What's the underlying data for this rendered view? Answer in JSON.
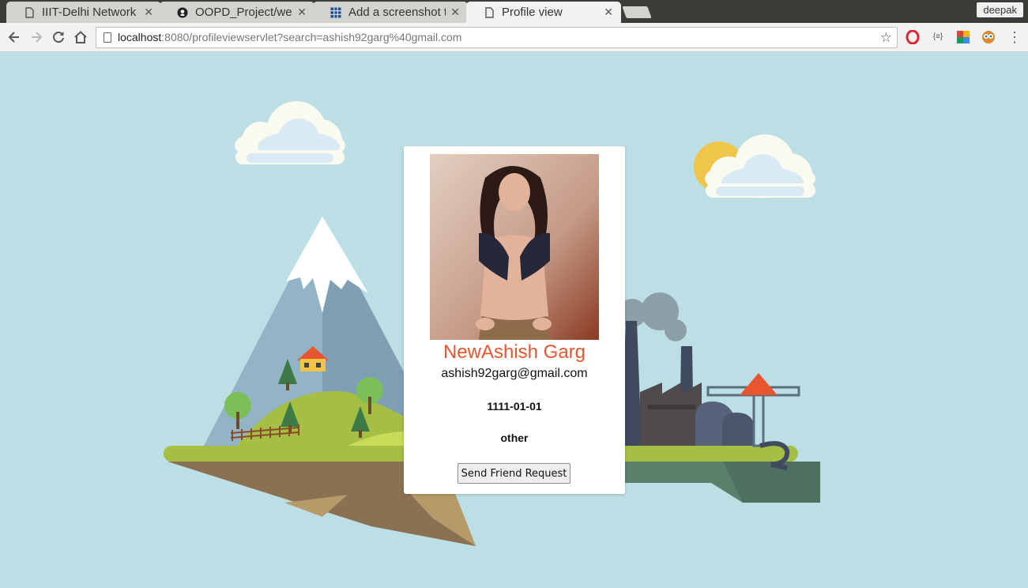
{
  "browser": {
    "tabs": [
      {
        "title": "IIIT-Delhi Network S",
        "icon": "page-icon",
        "active": false
      },
      {
        "title": "OOPD_Project/wel",
        "icon": "github-icon",
        "active": false
      },
      {
        "title": "Add a screenshot to",
        "icon": "grid-icon",
        "active": false
      },
      {
        "title": "Profile view",
        "icon": "page-icon",
        "active": true
      }
    ],
    "tab_close": "✕",
    "user": "deepak",
    "url_host": "localhost",
    "url_rest": ":8080/profileviewservlet?search=ashish92garg%40gmail.com",
    "extensions": [
      "opera-icon",
      "json-icon",
      "color-icon",
      "owl-icon"
    ]
  },
  "profile": {
    "name": "NewAshish Garg",
    "email": "ashish92garg@gmail.com",
    "dob": "1111-01-01",
    "gender": "other",
    "friend_button": "Send Friend Request"
  },
  "colors": {
    "background": "#bcdfe6",
    "name_accent": "#e8552f"
  }
}
